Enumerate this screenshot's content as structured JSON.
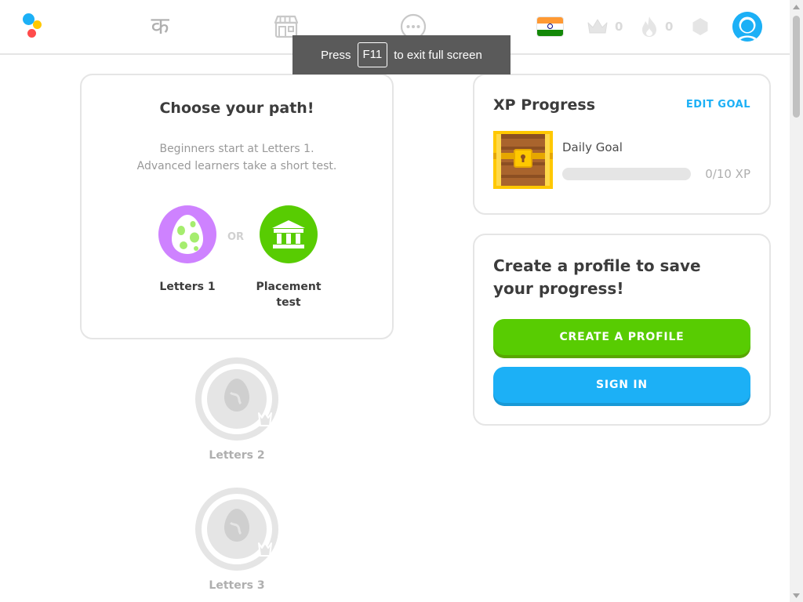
{
  "nav": {
    "learn_glyph": "क",
    "learn_icon": "learn-character-icon",
    "shop_icon": "shop-icon",
    "more_icon": "more-icon",
    "course_flag": "india-flag",
    "crowns": "0",
    "streak": "0"
  },
  "fullscreen_toast": {
    "prefix": "Press",
    "key": "F11",
    "suffix": "to exit full screen"
  },
  "path_card": {
    "title": "Choose your path!",
    "subtitle_line1": "Beginners start at Letters 1.",
    "subtitle_line2": "Advanced learners take a short test.",
    "or_label": "OR",
    "option_letters": "Letters 1",
    "option_placement_line1": "Placement",
    "option_placement_line2": "test"
  },
  "locked_skills": [
    {
      "label": "Letters 2"
    },
    {
      "label": "Letters 3"
    }
  ],
  "xp_card": {
    "title": "XP Progress",
    "edit_goal": "EDIT GOAL",
    "daily_goal_label": "Daily Goal",
    "progress_fraction": 0,
    "progress_text": "0/10 XP"
  },
  "profile_card": {
    "title": "Create a profile to save your progress!",
    "create_button": "CREATE A PROFILE",
    "signin_button": "SIGN IN"
  },
  "colors": {
    "brand_green": "#58cc02",
    "brand_blue": "#1cb0f6",
    "skill_purple": "#ce82ff",
    "muted_gray": "#afafaf"
  }
}
